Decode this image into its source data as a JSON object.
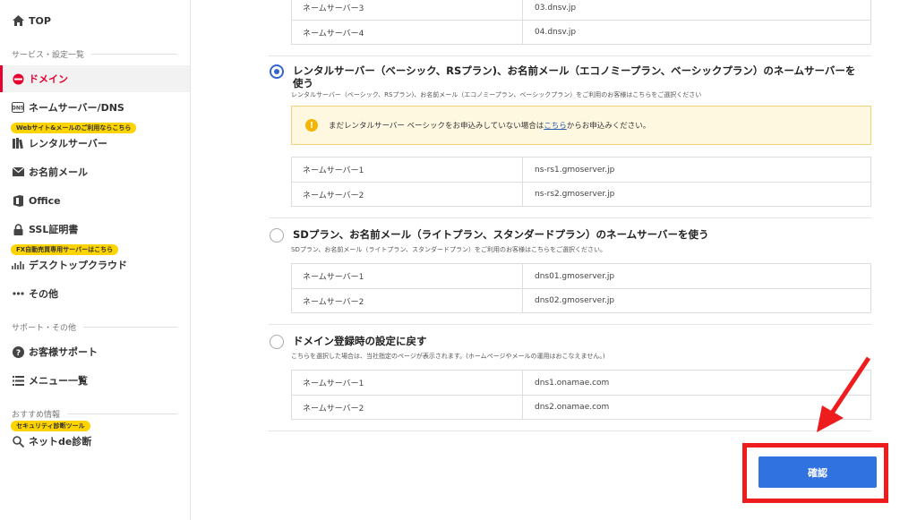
{
  "sidebar": {
    "top_label": "TOP",
    "section1": "サービス・設定一覧",
    "domain": "ドメイン",
    "nameserver": "ネームサーバー/DNS",
    "badge_web": "Webサイト&メールのご利用ならこちら",
    "rental": "レンタルサーバー",
    "mail": "お名前メール",
    "office": "Office",
    "ssl": "SSL証明書",
    "badge_fx": "FX自動売買専用サーバーはこちら",
    "desktop": "デスクトップクラウド",
    "other": "その他",
    "section2": "サポート・その他",
    "support": "お客様サポート",
    "menu": "メニュー一覧",
    "section3": "おすすめ情報",
    "badge_security": "セキュリティ診断ツール",
    "netde": "ネットde診断"
  },
  "top_table": {
    "rows": [
      {
        "label": "ネームサーバー3",
        "value": "03.dnsv.jp"
      },
      {
        "label": "ネームサーバー4",
        "value": "04.dnsv.jp"
      }
    ]
  },
  "option_rental": {
    "title": "レンタルサーバー（ベーシック、RSプラン)、お名前メール（エコノミープラン、ベーシックプラン）のネームサーバーを使う",
    "desc": "レンタルサーバー（ベーシック、RSプラン)、お名前メール（エコノミープラン、ベーシックプラン）をご利用のお客様はこちらをご選択ください",
    "warn_before": "まだレンタルサーバー ベーシックをお申込みしていない場合は",
    "warn_link": "こちら",
    "warn_after": "からお申込みください。",
    "rows": [
      {
        "label": "ネームサーバー1",
        "value": "ns-rs1.gmoserver.jp"
      },
      {
        "label": "ネームサーバー2",
        "value": "ns-rs2.gmoserver.jp"
      }
    ]
  },
  "option_sd": {
    "title": "SDプラン、お名前メール（ライトプラン、スタンダードプラン）のネームサーバーを使う",
    "desc": "SDプラン、お名前メール（ライトプラン、スタンダードプラン）をご利用のお客様はこちらをご選択ください。",
    "rows": [
      {
        "label": "ネームサーバー1",
        "value": "dns01.gmoserver.jp"
      },
      {
        "label": "ネームサーバー2",
        "value": "dns02.gmoserver.jp"
      }
    ]
  },
  "option_default": {
    "title": "ドメイン登録時の設定に戻す",
    "desc": "こちらを選択した場合は、当社指定のページが表示されます。(ホームページやメールの運用はおこなえません。)",
    "rows": [
      {
        "label": "ネームサーバー1",
        "value": "dns1.onamae.com"
      },
      {
        "label": "ネームサーバー2",
        "value": "dns2.onamae.com"
      }
    ]
  },
  "confirm_label": "確認",
  "colors": {
    "accent_red": "#e6002d",
    "button_blue": "#2f72e0",
    "annotation_red": "#ee1c1c"
  }
}
